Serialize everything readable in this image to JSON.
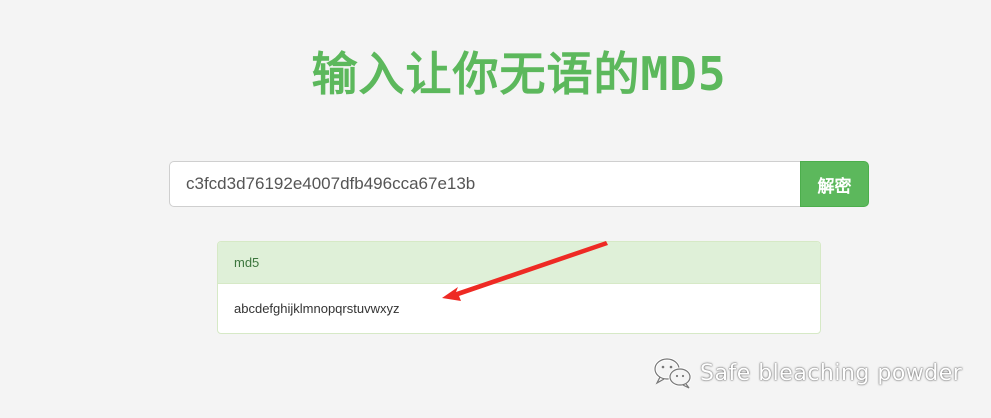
{
  "header": {
    "title": "输入让你无语的MD5"
  },
  "search": {
    "value": "c3fcd3d76192e4007dfb496cca67e13b",
    "button_label": "解密"
  },
  "result": {
    "heading": "md5",
    "plaintext": "abcdefghijklmnopqrstuvwxyz"
  },
  "watermark": {
    "icon": "wechat-icon",
    "text": "Safe bleaching powder"
  },
  "colors": {
    "accent": "#5cb85c",
    "panel_heading_bg": "#dff0d8",
    "arrow": "#ee2a24"
  }
}
